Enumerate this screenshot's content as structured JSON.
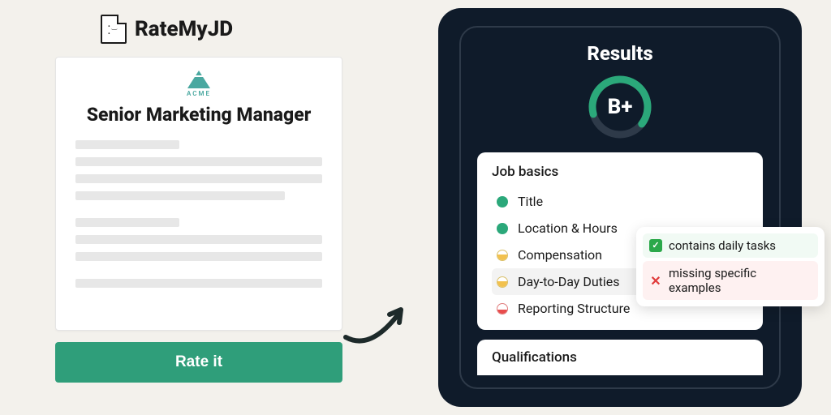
{
  "brand": {
    "name": "RateMyJD"
  },
  "jd": {
    "company": "ACME",
    "title": "Senior Marketing Manager"
  },
  "cta": {
    "rate_label": "Rate it"
  },
  "results": {
    "heading": "Results",
    "grade": "B+",
    "sections": [
      {
        "title": "Job basics",
        "items": [
          {
            "label": "Title",
            "status": "green"
          },
          {
            "label": "Location & Hours",
            "status": "green"
          },
          {
            "label": "Compensation",
            "status": "amber"
          },
          {
            "label": "Day-to-Day Duties",
            "status": "amber",
            "hovered": true
          },
          {
            "label": "Reporting Structure",
            "status": "red"
          }
        ]
      },
      {
        "title": "Qualifications"
      }
    ]
  },
  "tooltip": {
    "good": "contains daily tasks",
    "bad": "missing specific examples"
  }
}
